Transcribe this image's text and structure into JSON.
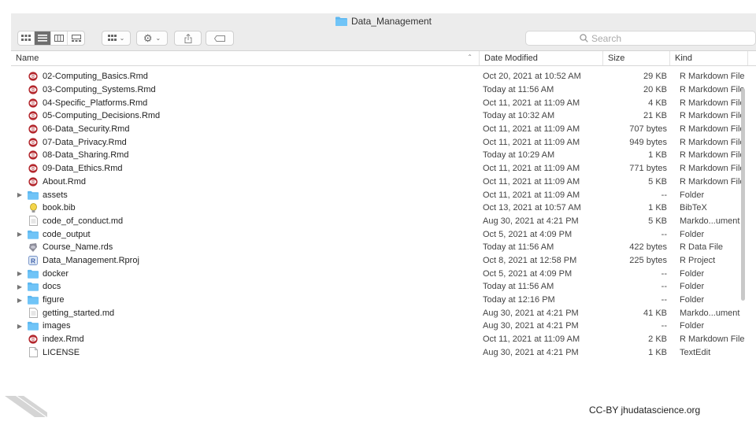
{
  "window": {
    "title": "Data_Management"
  },
  "toolbar": {
    "search_placeholder": "Search"
  },
  "columns": {
    "name": "Name",
    "date": "Date Modified",
    "size": "Size",
    "kind": "Kind"
  },
  "files": [
    {
      "name": "02-Computing_Basics.Rmd",
      "date": "Oct 20, 2021 at 10:52 AM",
      "size": "29 KB",
      "kind": "R Markdown File",
      "icon": "rmd-icon",
      "folder": false
    },
    {
      "name": "03-Computing_Systems.Rmd",
      "date": "Today at 11:56 AM",
      "size": "20 KB",
      "kind": "R Markdown File",
      "icon": "rmd-icon",
      "folder": false
    },
    {
      "name": "04-Specific_Platforms.Rmd",
      "date": "Oct 11, 2021 at 11:09 AM",
      "size": "4 KB",
      "kind": "R Markdown File",
      "icon": "rmd-icon",
      "folder": false
    },
    {
      "name": "05-Computing_Decisions.Rmd",
      "date": "Today at 10:32 AM",
      "size": "21 KB",
      "kind": "R Markdown File",
      "icon": "rmd-icon",
      "folder": false
    },
    {
      "name": "06-Data_Security.Rmd",
      "date": "Oct 11, 2021 at 11:09 AM",
      "size": "707 bytes",
      "kind": "R Markdown File",
      "icon": "rmd-icon",
      "folder": false
    },
    {
      "name": "07-Data_Privacy.Rmd",
      "date": "Oct 11, 2021 at 11:09 AM",
      "size": "949 bytes",
      "kind": "R Markdown File",
      "icon": "rmd-icon",
      "folder": false
    },
    {
      "name": "08-Data_Sharing.Rmd",
      "date": "Today at 10:29 AM",
      "size": "1 KB",
      "kind": "R Markdown File",
      "icon": "rmd-icon",
      "folder": false
    },
    {
      "name": "09-Data_Ethics.Rmd",
      "date": "Oct 11, 2021 at 11:09 AM",
      "size": "771 bytes",
      "kind": "R Markdown File",
      "icon": "rmd-icon",
      "folder": false
    },
    {
      "name": "About.Rmd",
      "date": "Oct 11, 2021 at 11:09 AM",
      "size": "5 KB",
      "kind": "R Markdown File",
      "icon": "rmd-icon",
      "folder": false
    },
    {
      "name": "assets",
      "date": "Oct 11, 2021 at 11:09 AM",
      "size": "--",
      "kind": "Folder",
      "icon": "folder-icon",
      "folder": true
    },
    {
      "name": "book.bib",
      "date": "Oct 13, 2021 at 10:57 AM",
      "size": "1 KB",
      "kind": "BibTeX",
      "icon": "bib-icon",
      "folder": false
    },
    {
      "name": "code_of_conduct.md",
      "date": "Aug 30, 2021 at 4:21 PM",
      "size": "5 KB",
      "kind": "Markdo...ument",
      "icon": "document-icon",
      "folder": false
    },
    {
      "name": "code_output",
      "date": "Oct 5, 2021 at 4:09 PM",
      "size": "--",
      "kind": "Folder",
      "icon": "folder-icon",
      "folder": true
    },
    {
      "name": "Course_Name.rds",
      "date": "Today at 11:56 AM",
      "size": "422 bytes",
      "kind": "R Data File",
      "icon": "rds-icon",
      "folder": false
    },
    {
      "name": "Data_Management.Rproj",
      "date": "Oct 8, 2021 at 12:58 PM",
      "size": "225 bytes",
      "kind": "R Project",
      "icon": "rproj-icon",
      "folder": false
    },
    {
      "name": "docker",
      "date": "Oct 5, 2021 at 4:09 PM",
      "size": "--",
      "kind": "Folder",
      "icon": "folder-icon",
      "folder": true
    },
    {
      "name": "docs",
      "date": "Today at 11:56 AM",
      "size": "--",
      "kind": "Folder",
      "icon": "folder-icon",
      "folder": true
    },
    {
      "name": "figure",
      "date": "Today at 12:16 PM",
      "size": "--",
      "kind": "Folder",
      "icon": "folder-icon",
      "folder": true
    },
    {
      "name": "getting_started.md",
      "date": "Aug 30, 2021 at 4:21 PM",
      "size": "41 KB",
      "kind": "Markdo...ument",
      "icon": "document-icon",
      "folder": false
    },
    {
      "name": "images",
      "date": "Aug 30, 2021 at 4:21 PM",
      "size": "--",
      "kind": "Folder",
      "icon": "folder-icon",
      "folder": true
    },
    {
      "name": "index.Rmd",
      "date": "Oct 11, 2021 at 11:09 AM",
      "size": "2 KB",
      "kind": "R Markdown File",
      "icon": "rmd-icon",
      "folder": false
    },
    {
      "name": "LICENSE",
      "date": "Aug 30, 2021 at 4:21 PM",
      "size": "1 KB",
      "kind": "TextEdit",
      "icon": "blank-file-icon",
      "folder": false
    }
  ],
  "footer": {
    "credit": "CC-BY jhudatascience.org"
  },
  "colors": {
    "folder": "#5db7f0",
    "rmd": "#b3262c",
    "active_view": "#6e6e6e"
  }
}
